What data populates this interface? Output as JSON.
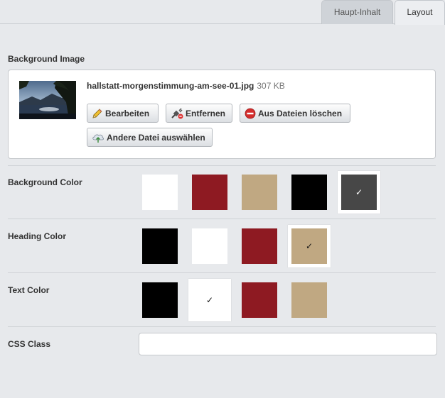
{
  "tabs": [
    {
      "label": "Haupt-Inhalt",
      "active": false
    },
    {
      "label": "Layout",
      "active": true
    }
  ],
  "background_image": {
    "label": "Background Image",
    "filename": "hallstatt-morgenstimmung-am-see-01.jpg",
    "filesize": "307 KB",
    "buttons": {
      "edit": "Bearbeiten",
      "remove": "Entfernen",
      "delete": "Aus Dateien löschen",
      "choose": "Andere Datei auswählen"
    }
  },
  "background_color": {
    "label": "Background Color",
    "options": [
      "#ffffff",
      "#8e1a22",
      "#c0a882",
      "#000000",
      "#474747"
    ],
    "selected": 4
  },
  "heading_color": {
    "label": "Heading Color",
    "options": [
      "#000000",
      "#ffffff",
      "#8e1a22",
      "#c0a882"
    ],
    "selected": 3
  },
  "text_color": {
    "label": "Text Color",
    "options": [
      "#000000",
      "#ffffff",
      "#8e1a22",
      "#c0a882"
    ],
    "selected": 1
  },
  "css_class": {
    "label": "CSS Class",
    "value": "",
    "placeholder": ""
  },
  "check_mark": "✓"
}
